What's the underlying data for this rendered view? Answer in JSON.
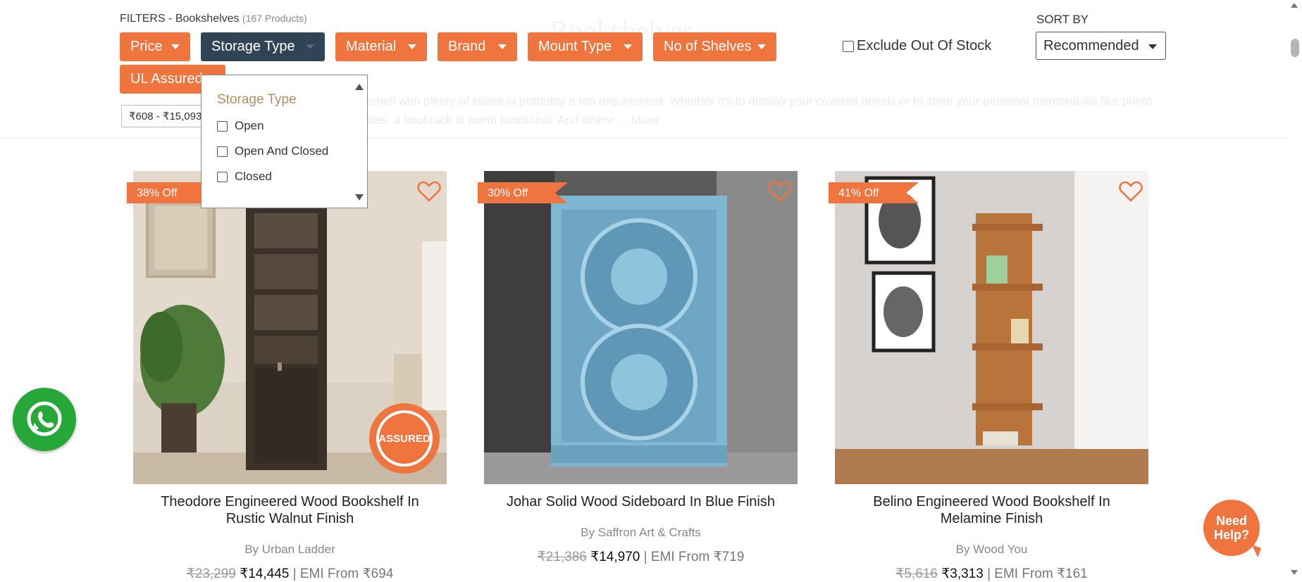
{
  "filters": {
    "label": "FILTERS - Bookshelves",
    "count": "(167 Products)",
    "buttons": [
      "Price",
      "Storage Type",
      "Material",
      "Brand",
      "Mount Type",
      "No of Shelves",
      "UL Assured"
    ],
    "price_range": "₹608 - ₹15,093"
  },
  "exclude_label": "Exclude Out Of Stock",
  "sort": {
    "label": "SORT BY",
    "value": "Recommended"
  },
  "background": {
    "title": "Bookshelves",
    "description": "Investing in a quality bookshelf with plenty of space is probably a top requirement. Whether it's to display your coveted novels or to store your personal memorabilia like photo frames and travel collectibles, a bookrack is worth functional. And where ... More"
  },
  "dropdown": {
    "title": "Storage Type",
    "options": [
      "Open",
      "Open And Closed",
      "Closed"
    ]
  },
  "products": [
    {
      "discount": "38% Off",
      "name_line1": "Theodore Engineered Wood Bookshelf In",
      "name_line2": "Rustic Walnut Finish",
      "brand_prefix": "By",
      "brand": "Urban Ladder",
      "old_price": "₹23,299",
      "price": "₹14,445",
      "emi": "| EMI From ₹694",
      "assured_text": "ASSURED"
    },
    {
      "discount": "30% Off",
      "name_line1": "Johar Solid Wood Sideboard In Blue Finish",
      "name_line2": "",
      "brand_prefix": "By",
      "brand": "Saffron Art & Crafts",
      "old_price": "₹21,386",
      "price": "₹14,970",
      "emi": "| EMI From ₹719"
    },
    {
      "discount": "41% Off",
      "name_line1": "Belino Engineered Wood Bookshelf In",
      "name_line2": "Melamine Finish",
      "brand_prefix": "By",
      "brand": "Wood You",
      "old_price": "₹5,616",
      "price": "₹3,313",
      "emi": "| EMI From ₹161"
    }
  ],
  "need_help": {
    "line1": "Need",
    "line2": "Help?"
  },
  "colors": {
    "accent": "#f0743e",
    "active_filter": "#2f4454",
    "whatsapp": "#25a838"
  }
}
